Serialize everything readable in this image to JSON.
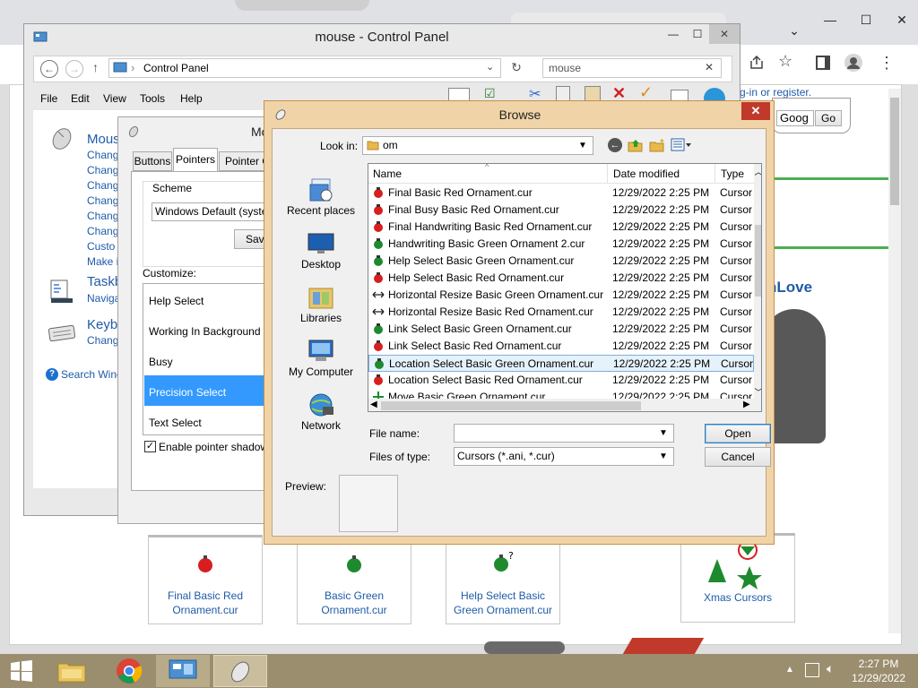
{
  "chrome": {
    "address_text": "mouse",
    "signin_text": "g-in or ",
    "register_text": "register.",
    "search_value": "Goog",
    "go_label": "Go",
    "love_text": "nLove",
    "cards": [
      {
        "label_line1": "Final Basic Red",
        "label_line2": "Ornament.cur",
        "color": "#d81e1e"
      },
      {
        "label_line1": "Basic Green",
        "label_line2": "Ornament.cur",
        "color": "#1e8a2e"
      },
      {
        "label_line1": "Help Select Basic",
        "label_line2": "Green Ornament.cur",
        "color": "#1e8a2e"
      },
      {
        "label_line1": "Xmas Cursors",
        "label_line2": "",
        "color": "#1e8a2e"
      }
    ]
  },
  "control_panel": {
    "title": "mouse - Control Panel",
    "breadcrumb": "Control Panel",
    "search_value": "mouse",
    "menu": [
      "File",
      "Edit",
      "View",
      "Tools",
      "Help"
    ],
    "sections": [
      {
        "heading": "Mous",
        "links": [
          "Chang",
          "Chang",
          "Chang",
          "Chang",
          "Chang",
          "Chang",
          "Custo",
          "Make i"
        ]
      },
      {
        "heading": "Taskb",
        "links": [
          "Naviga"
        ]
      },
      {
        "heading": "Keyb",
        "links": [
          "Chang"
        ]
      }
    ],
    "search_windows": "Search Wind"
  },
  "mouse_properties": {
    "title": "Mo",
    "tabs": [
      "Buttons",
      "Pointers",
      "Pointer O"
    ],
    "scheme_label": "Scheme",
    "scheme_value": "Windows Default (system",
    "save_label": "Save",
    "customize_label": "Customize:",
    "pointers": [
      "Help Select",
      "Working In Background",
      "Busy",
      "Precision Select",
      "Text Select"
    ],
    "selected_pointer": "Precision Select",
    "shadow_label": "Enable pointer shadow",
    "shadow_checked": true
  },
  "browse": {
    "title": "Browse",
    "look_in_label": "Look in:",
    "look_in_value": "om",
    "places": [
      "Recent places",
      "Desktop",
      "Libraries",
      "My Computer",
      "Network"
    ],
    "columns": {
      "name": "Name",
      "date": "Date modified",
      "type": "Type"
    },
    "files": [
      {
        "name": "Final Basic Red Ornament.cur",
        "date": "12/29/2022 2:25 PM",
        "type": "Cursor",
        "icon": "red-ornament-icon"
      },
      {
        "name": "Final Busy Basic Red Ornament.cur",
        "date": "12/29/2022 2:25 PM",
        "type": "Cursor",
        "icon": "red-ornament-icon"
      },
      {
        "name": "Final Handwriting Basic Red Ornament.cur",
        "date": "12/29/2022 2:25 PM",
        "type": "Cursor",
        "icon": "red-ornament-icon"
      },
      {
        "name": "Handwriting Basic Green Ornament 2.cur",
        "date": "12/29/2022 2:25 PM",
        "type": "Cursor",
        "icon": "green-ornament-icon"
      },
      {
        "name": "Help Select Basic Green Ornament.cur",
        "date": "12/29/2022 2:25 PM",
        "type": "Cursor",
        "icon": "green-ornament-icon"
      },
      {
        "name": "Help Select Basic Red Ornament.cur",
        "date": "12/29/2022 2:25 PM",
        "type": "Cursor",
        "icon": "red-ornament-icon"
      },
      {
        "name": "Horizontal Resize Basic Green Ornament.cur",
        "date": "12/29/2022 2:25 PM",
        "type": "Cursor",
        "icon": "horizontal-resize-icon"
      },
      {
        "name": "Horizontal Resize Basic Red Ornament.cur",
        "date": "12/29/2022 2:25 PM",
        "type": "Cursor",
        "icon": "horizontal-resize-icon"
      },
      {
        "name": "Link Select Basic Green Ornament.cur",
        "date": "12/29/2022 2:25 PM",
        "type": "Cursor",
        "icon": "green-ornament-icon"
      },
      {
        "name": "Link Select Basic Red Ornament.cur",
        "date": "12/29/2022 2:25 PM",
        "type": "Cursor",
        "icon": "red-ornament-icon"
      },
      {
        "name": "Location Select Basic Green Ornament.cur",
        "date": "12/29/2022 2:25 PM",
        "type": "Cursor",
        "icon": "green-ornament-icon"
      },
      {
        "name": "Location Select Basic Red Ornament.cur",
        "date": "12/29/2022 2:25 PM",
        "type": "Cursor",
        "icon": "red-ornament-icon"
      },
      {
        "name": "Move Basic Green Ornament.cur",
        "date": "12/29/2022 2:25 PM",
        "type": "Cursor",
        "icon": "move-icon"
      }
    ],
    "selected_file": "Location Select Basic Green Ornament.cur",
    "file_name_label": "File name:",
    "file_name_value": "",
    "files_of_type_label": "Files of type:",
    "files_of_type_value": "Cursors (*.ani, *.cur)",
    "open_label": "Open",
    "cancel_label": "Cancel",
    "preview_label": "Preview:"
  },
  "taskbar": {
    "time": "2:27 PM",
    "date": "12/29/2022"
  },
  "colors": {
    "link_blue": "#1e5ba8",
    "dialog_frame": "#f0d4a8",
    "selection_blue": "#3399ff",
    "taskbar": "#9b8e6e"
  }
}
